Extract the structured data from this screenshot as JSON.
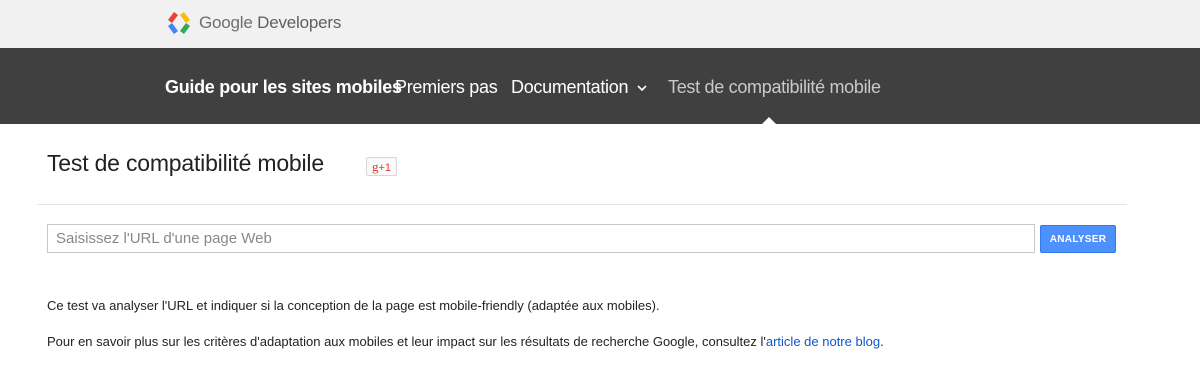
{
  "header": {
    "logo_text_1": "Google",
    "logo_text_2": "Developers",
    "logo_icon": "google-developers-logo-icon"
  },
  "nav": {
    "items": [
      {
        "label": "Guide pour les sites mobiles"
      },
      {
        "label": "Premiers pas"
      },
      {
        "label": "Documentation"
      },
      {
        "label": "Test de compatibilité mobile"
      }
    ],
    "dropdown_icon": "chevron-down-icon"
  },
  "main": {
    "title": "Test de compatibilité mobile",
    "gplus_g": "g",
    "gplus_plus": "+1",
    "url_placeholder": "Saisissez l'URL d'une page Web",
    "url_value": "",
    "analyze_label": "ANALYSER",
    "paragraph1": "Ce test va analyser l'URL et indiquer si la conception de la page est mobile-friendly (adaptée aux mobiles).",
    "paragraph2_before": "Pour en savoir plus sur les critères d'adaptation aux mobiles et leur impact sur les résultats de recherche Google, consultez l'",
    "paragraph2_link": "article de notre blog",
    "paragraph2_after": "."
  },
  "colors": {
    "topbar": "#f1f1f1",
    "navbar": "#404040",
    "button": "#4d90fe",
    "link": "#1155cc",
    "gplus": "#d73d32"
  }
}
